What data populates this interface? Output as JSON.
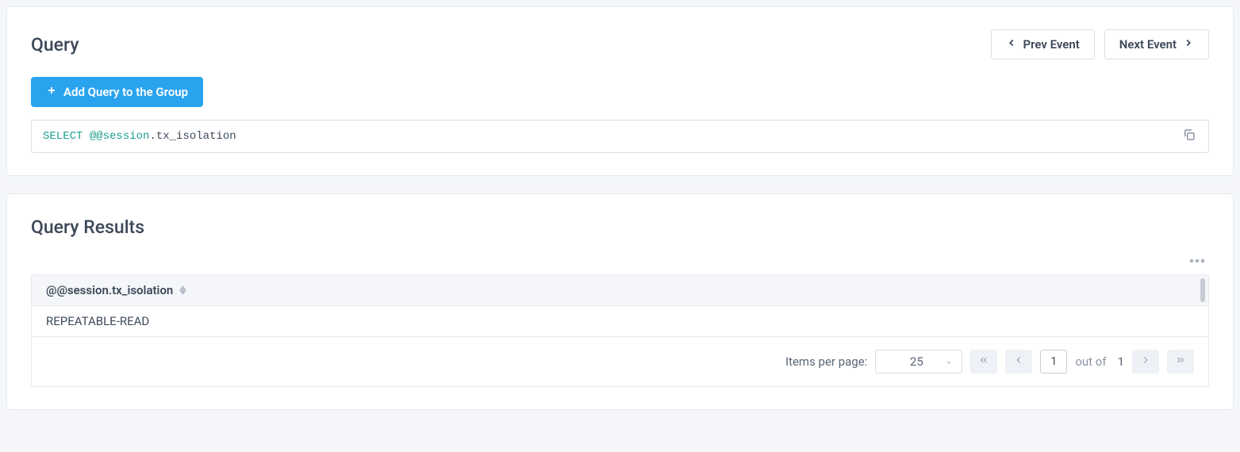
{
  "query_panel": {
    "title": "Query",
    "prev_label": "Prev Event",
    "next_label": "Next Event",
    "add_button_label": "Add Query to the Group",
    "sql": {
      "keyword": "SELECT",
      "session_part": "@@session",
      "rest": ".tx_isolation"
    }
  },
  "results_panel": {
    "title": "Query Results",
    "column_header": "@@session.tx_isolation",
    "rows": [
      "REPEATABLE-READ"
    ],
    "pagination": {
      "items_label": "Items per page:",
      "per_page": "25",
      "current_page": "1",
      "out_of_label": "out of",
      "total_pages": "1"
    }
  }
}
